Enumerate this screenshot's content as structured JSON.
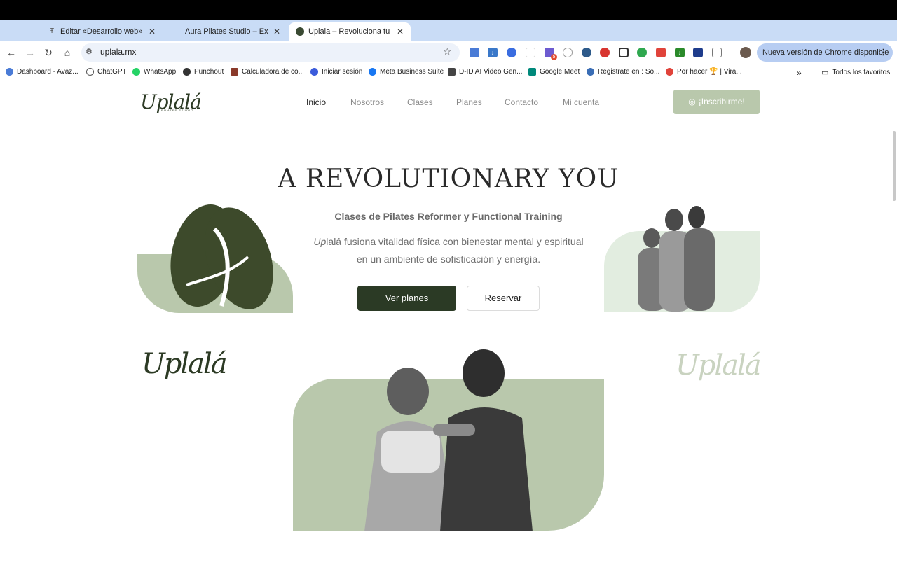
{
  "browser": {
    "tabs": [
      {
        "title": "Editar «Desarrollo web» con",
        "icon": "wordpress-icon"
      },
      {
        "title": "Aura Pilates Studio – Excelen",
        "icon": "globe-icon"
      },
      {
        "title": "Uplala – Revoluciona tu Fitne",
        "icon": "uplala-favicon-icon",
        "active": true
      }
    ],
    "url": "uplala.mx",
    "update_button": "Nueva versión de Chrome disponible",
    "bookmarks": [
      "Dashboard - Avaz...",
      "ChatGPT",
      "WhatsApp",
      "Punchout",
      "Calculadora de co...",
      "Iniciar sesión",
      "Meta Business Suite",
      "D-ID AI Video Gen...",
      "Google Meet",
      "Registrate en : So...",
      "Por hacer 🏆 | Vira..."
    ],
    "all_bookmarks": "Todos los favoritos",
    "extension_badge": "5"
  },
  "site": {
    "logo": "Uplalá",
    "logo_sub": "PILATES STUDIO",
    "nav": [
      "Inicio",
      "Nosotros",
      "Clases",
      "Planes",
      "Contacto",
      "Mi cuenta"
    ],
    "signup": "¡Inscribirme!",
    "hero": {
      "title": "A REVOLUTIONARY YOU",
      "subtitle": "Clases de Pilates Reformer y Functional Training",
      "desc_italic": "Up",
      "desc_rest": "lalá fusiona vitalidad física con bienestar mental y espiritual en un ambiente de sofisticación y energía.",
      "btn_primary": "Ver planes",
      "btn_secondary": "Reservar"
    },
    "logo_dark": "Uplalá",
    "logo_light": "Uplalá"
  },
  "colors": {
    "brand_dark": "#2b3a25",
    "brand_sage": "#b9c8ac",
    "brand_mint": "#e2ede0"
  }
}
